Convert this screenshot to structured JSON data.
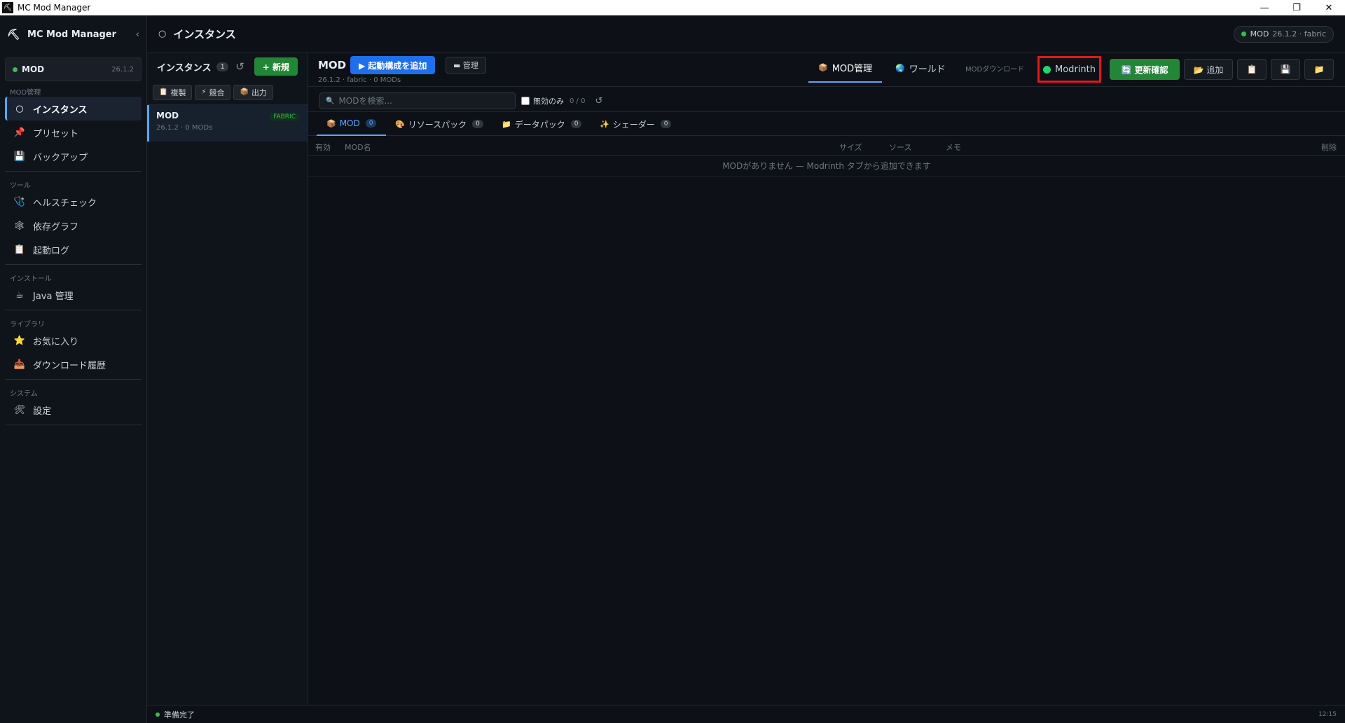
{
  "window": {
    "title": "MC Mod Manager",
    "minimize": "—",
    "restore": "❐",
    "close": "✕"
  },
  "sidebar": {
    "logo_icon": "⛏",
    "title": "MC Mod Manager",
    "collapse_icon": "‹",
    "current_instance": {
      "name": "MOD",
      "version": "26.1.2"
    },
    "sections": {
      "mod": "MOD管理",
      "tools": "ツール",
      "install": "インストール",
      "library": "ライブラリ",
      "system": "システム"
    },
    "items": {
      "instances": {
        "icon": "○",
        "label": "インスタンス"
      },
      "presets": {
        "icon": "📌",
        "label": "プリセット"
      },
      "backup": {
        "icon": "💾",
        "label": "バックアップ"
      },
      "health": {
        "icon": "🩺",
        "label": "ヘルスチェック"
      },
      "depgraph": {
        "icon": "🕸",
        "label": "依存グラフ"
      },
      "launchlog": {
        "icon": "📋",
        "label": "起動ログ"
      },
      "java": {
        "icon": "☕",
        "label": "Java 管理"
      },
      "favorites": {
        "icon": "⭐",
        "label": "お気に入り"
      },
      "downloads": {
        "icon": "📥",
        "label": "ダウンロード履歴"
      },
      "settings": {
        "icon": "🛠",
        "label": "設定"
      }
    }
  },
  "header": {
    "icon": "○",
    "title": "インスタンス",
    "badge": {
      "name": "MOD",
      "sub": "26.1.2 · fabric"
    }
  },
  "instance_list": {
    "title": "インスタンス",
    "count": "1",
    "refresh_icon": "↺",
    "new_button": "+ 新規",
    "actions": {
      "duplicate": {
        "icon": "📋",
        "label": "複製"
      },
      "conflict": {
        "icon": "⚡",
        "label": "競合"
      },
      "export": {
        "icon": "📦",
        "label": "出力"
      }
    },
    "items": [
      {
        "name": "MOD",
        "meta": "26.1.2 · 0 MODs",
        "loader": "FABRIC"
      }
    ]
  },
  "main": {
    "title": "MOD",
    "subtitle": "26.1.2 · fabric · 0 MODs",
    "launch_button": "▶ 起動構成を追加",
    "manage_button": "▬ 管理",
    "tabs": {
      "mod_manage": {
        "icon": "📦",
        "label": "MOD管理"
      },
      "world": {
        "icon": "🌏",
        "label": "ワールド"
      }
    },
    "mod_download_label": "MODダウンロード",
    "modrinth_label": "Modrinth",
    "update_button": "🔄 更新確認",
    "add_button": "📂 追加",
    "icon_buttons": {
      "clipboard": "📋",
      "save": "💾",
      "folder": "📁"
    },
    "search_placeholder": "MODを検索...",
    "search_icon": "🔍",
    "disabled_only_label": "無効のみ",
    "disabled_count": "0 / 0",
    "reload_icon": "↺",
    "categories": [
      {
        "icon": "📦",
        "label": "MOD",
        "count": "0"
      },
      {
        "icon": "🎨",
        "label": "リソースパック",
        "count": "0"
      },
      {
        "icon": "📁",
        "label": "データパック",
        "count": "0"
      },
      {
        "icon": "✨",
        "label": "シェーダー",
        "count": "0"
      }
    ],
    "columns": {
      "enabled": "有効",
      "name": "MOD名",
      "size": "サイズ",
      "source": "ソース",
      "memo": "メモ",
      "delete": "削除"
    },
    "empty_message": "MODがありません — Modrinth タブから追加できます"
  },
  "status": {
    "text": "準備完了",
    "time": "12:15"
  },
  "colors": {
    "accent": "#58a6ff",
    "success": "#238636",
    "highlight": "#e01919",
    "modrinth": "#1bd96a"
  }
}
